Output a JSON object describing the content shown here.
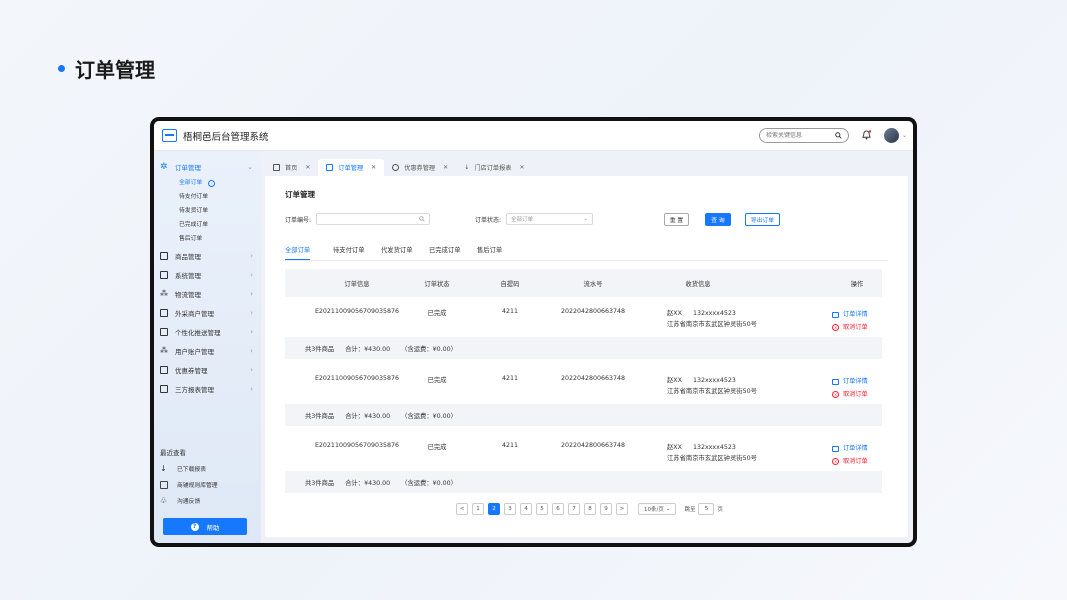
{
  "slide": {
    "title": "订单管理"
  },
  "app": {
    "title": "梧桐邑后台管理系统"
  },
  "header": {
    "search_placeholder": "检索关键信息"
  },
  "sidebar": {
    "items": [
      {
        "label": "订单管理"
      },
      {
        "label": "商品管理"
      },
      {
        "label": "系统管理"
      },
      {
        "label": "物流管理"
      },
      {
        "label": "外采商户管理"
      },
      {
        "label": "个性化推送管理"
      },
      {
        "label": "用户账户管理"
      },
      {
        "label": "优惠券管理"
      },
      {
        "label": "三方报表管理"
      }
    ],
    "sub_items": [
      {
        "label": "全部订单"
      },
      {
        "label": "待支付订单"
      },
      {
        "label": "待发货订单"
      },
      {
        "label": "已完成订单"
      },
      {
        "label": "售后订单"
      }
    ],
    "recent_title": "最近查看",
    "recent": [
      {
        "label": "已下载报表"
      },
      {
        "label": "商铺规则库管理"
      },
      {
        "label": "沟通反馈"
      }
    ],
    "help_label": "帮助"
  },
  "tabs": [
    {
      "label": "首页"
    },
    {
      "label": "订单管理"
    },
    {
      "label": "优惠券管理"
    },
    {
      "label": "门店订单报表"
    }
  ],
  "panel": {
    "title": "订单管理",
    "filter_order_label": "订单编号:",
    "filter_status_label": "订单状态:",
    "filter_status_placeholder": "全部订单",
    "reset_label": "重 置",
    "query_label": "查 询",
    "export_label": "导出订单",
    "status_tabs": [
      "全部订单",
      "待支付订单",
      "代发货订单",
      "已完成订单",
      "售后订单"
    ]
  },
  "table": {
    "headers": [
      "订单信息",
      "订单状态",
      "自提码",
      "流水号",
      "收货信息",
      "操作"
    ],
    "orders": [
      {
        "order_no": "E20211009056709035876",
        "status": "已完成",
        "pickup": "4211",
        "serial": "2022042800663748",
        "name": "赵XX",
        "phone": "132xxxx4523",
        "address": "江苏省南京市玄武区钟灵街50号",
        "detail": "订单详情",
        "cancel": "取消订单",
        "count": "共3件商品",
        "total": "合计：¥430.00",
        "shipping": "（含运费：¥0.00）"
      },
      {
        "order_no": "E20211009056709035876",
        "status": "已完成",
        "pickup": "4211",
        "serial": "2022042800663748",
        "name": "赵XX",
        "phone": "132xxxx4523",
        "address": "江苏省南京市玄武区钟灵街50号",
        "detail": "订单详情",
        "cancel": "取消订单",
        "count": "共3件商品",
        "total": "合计：¥430.00",
        "shipping": "（含运费：¥0.00）"
      },
      {
        "order_no": "E20211009056709035876",
        "status": "已完成",
        "pickup": "4211",
        "serial": "2022042800663748",
        "name": "赵XX",
        "phone": "132xxxx4523",
        "address": "江苏省南京市玄武区钟灵街50号",
        "detail": "订单详情",
        "cancel": "取消订单",
        "count": "共3件商品",
        "total": "合计：¥430.00",
        "shipping": "（含运费：¥0.00）"
      }
    ]
  },
  "pagination": {
    "pages": [
      "1",
      "2",
      "3",
      "4",
      "5",
      "6",
      "7",
      "8",
      "9"
    ],
    "current": "2",
    "prev": "<",
    "next": ">",
    "page_size": "10条/页",
    "jump_label": "跳至",
    "jump_value": "5",
    "jump_suffix": "页"
  },
  "colors": {
    "accent": "#1677ff",
    "danger": "#f5222d"
  }
}
